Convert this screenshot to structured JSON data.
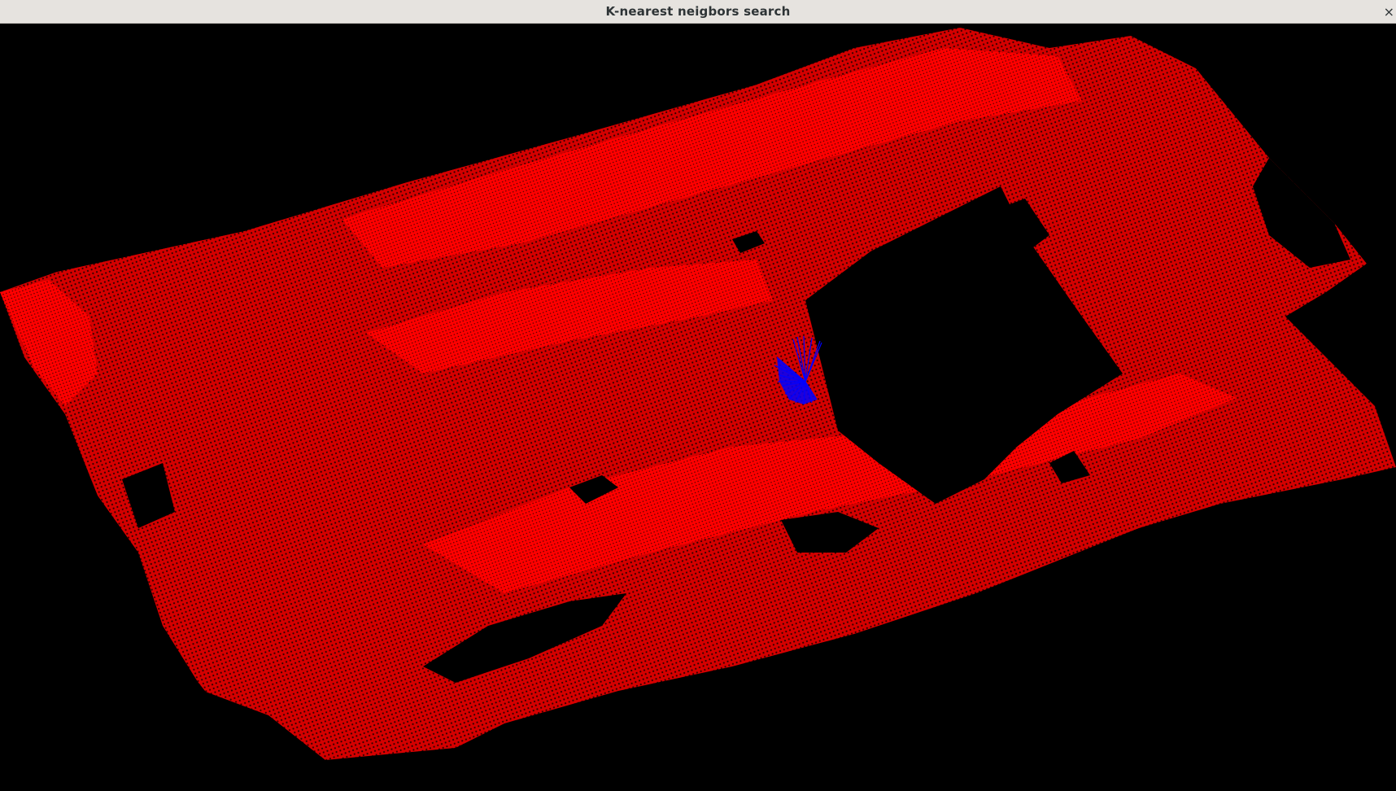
{
  "window": {
    "title": "K-nearest neigbors search",
    "close_glyph": "×"
  },
  "viewer": {
    "background_color": "#000000",
    "cloud_color": "#ff0000",
    "neighbors_color": "#0000ff"
  }
}
